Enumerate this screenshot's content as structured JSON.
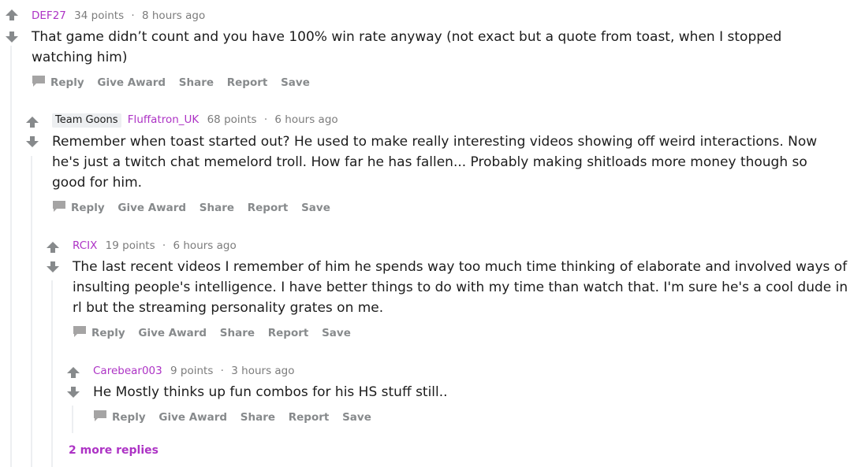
{
  "comments": [
    {
      "author": "DEF27",
      "points": "34 points",
      "time": "8 hours ago",
      "flair": "",
      "body": "That game didn’t count and you have 100% win rate anyway (not exact but a quote from toast, when I stopped watching him)"
    },
    {
      "author": "Fluffatron_UK",
      "points": "68 points",
      "time": "6 hours ago",
      "flair": "Team Goons",
      "body": "Remember when toast started out? He used to make really interesting videos showing off weird interactions. Now he's just a twitch chat memelord troll. How far he has fallen... Probably making shitloads more money though so good for him."
    },
    {
      "author": "RCIX",
      "points": "19 points",
      "time": "6 hours ago",
      "flair": "",
      "body": "The last recent videos I remember of him he spends way too much time thinking of elaborate and involved ways of insulting people's intelligence. I have better things to do with my time than watch that. I'm sure he's a cool dude in rl but the streaming personality grates on me."
    },
    {
      "author": "Carebear003",
      "points": "9 points",
      "time": "3 hours ago",
      "flair": "",
      "body": "He Mostly thinks up fun combos for his HS stuff still.."
    }
  ],
  "actions": {
    "reply": "Reply",
    "give_award": "Give Award",
    "share": "Share",
    "report": "Report",
    "save": "Save"
  },
  "separator": "·",
  "more_replies": "2 more replies",
  "colors": {
    "author": "#ad33c5",
    "meta": "#7c7c7c",
    "action": "#878a8c",
    "thread_line": "#edeff1",
    "vote_arrow": "#878a8c"
  }
}
